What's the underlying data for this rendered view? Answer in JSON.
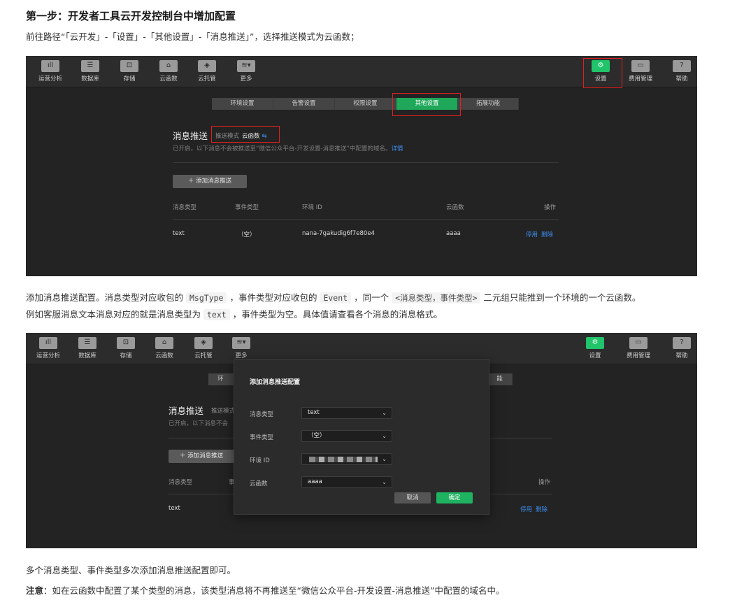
{
  "heading": "第一步：开发者工具云开发控制台中增加配置",
  "intro": "前往路径“「云开发」-「设置」-「其他设置」-「消息推送」”，选择推送模式为云函数；",
  "topbar": {
    "left": [
      {
        "label": "运营分析",
        "icon": "chart-icon",
        "glyph": "ıll"
      },
      {
        "label": "数据库",
        "icon": "database-icon",
        "glyph": "☰"
      },
      {
        "label": "存储",
        "icon": "storage-icon",
        "glyph": "⊡"
      },
      {
        "label": "云函数",
        "icon": "cloud-function-icon",
        "glyph": "⌂"
      },
      {
        "label": "云托管",
        "icon": "cloud-hosting-icon",
        "glyph": "◈"
      },
      {
        "label": "更多",
        "icon": "layers-icon",
        "glyph": "≋▾"
      }
    ],
    "right": [
      {
        "label": "设置",
        "icon": "gear-icon",
        "glyph": "⚙"
      },
      {
        "label": "费用管理",
        "icon": "card-icon",
        "glyph": "▭"
      },
      {
        "label": "帮助",
        "icon": "help-icon",
        "glyph": "?"
      }
    ]
  },
  "tabs": [
    "环境设置",
    "告警设置",
    "权限设置",
    "其他设置",
    "拓展功能"
  ],
  "section": {
    "title": "消息推送",
    "mode_label": "推送模式",
    "mode_value": "云函数",
    "mode_switch": "⇆",
    "desc": "已开启，以下消息不会被推送至“微信公众平台-开发设置-消息推送”中配置的域名。",
    "desc_link": "详情",
    "desc2_short": "已开启，以下消息不会",
    "mode_label_short": "推送模式",
    "add_button": "＋ 添加消息推送",
    "columns": [
      "消息类型",
      "事件类型",
      "环境 ID",
      "云函数",
      "操作"
    ],
    "row": {
      "msg_type": "text",
      "event_type": "（空）",
      "env_id": "nana-7gakudig6f7e80e4",
      "function": "aaaa",
      "disable": "停用",
      "delete": "删除"
    },
    "tab_fragment_1": "环",
    "tab_fragment_2": "能",
    "col_fragment": "事"
  },
  "para2": {
    "p1": "添加消息推送配置。消息类型对应收包的",
    "c1": "MsgType",
    "p2": "，事件类型对应收包的",
    "c2": "Event",
    "p3": "，同一个",
    "c3": "<消息类型，事件类型>",
    "p4": "二元组只能推到一个环境的一个云函数。",
    "p5": "例如客服消息文本消息对应的就是消息类型为",
    "c4": "text",
    "p6": "，事件类型为空。具体值请查看各个消息的消息格式。"
  },
  "modal": {
    "title": "添加消息推送配置",
    "fields": [
      {
        "label": "消息类型",
        "value": "text"
      },
      {
        "label": "事件类型",
        "value": "（空）"
      },
      {
        "label": "环境 ID",
        "value": ""
      },
      {
        "label": "云函数",
        "value": "aaaa"
      }
    ],
    "chevron": "⌄",
    "cancel": "取消",
    "ok": "确定"
  },
  "footer1": "多个消息类型、事件类型多次添加消息推送配置即可。",
  "note_label": "注意",
  "note_text": "：如在云函数中配置了某个类型的消息，该类型消息将不再推送至“微信公众平台-开发设置-消息推送”中配置的域名中。",
  "colors": {
    "accent_green": "#1fa85a",
    "link_blue": "#3d8ef0",
    "highlight_red": "#e02020",
    "console_bg": "#232323"
  }
}
